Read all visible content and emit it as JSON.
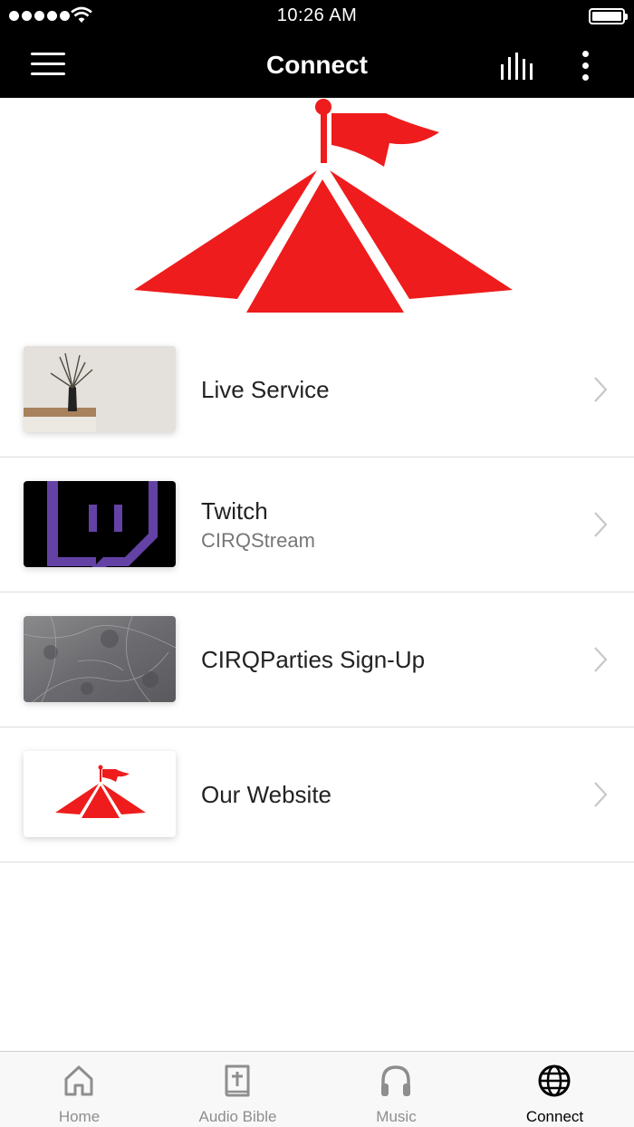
{
  "status_bar": {
    "time": "10:26 AM"
  },
  "nav": {
    "title": "Connect"
  },
  "colors": {
    "brand_red": "#ee1c1c",
    "nav_background": "#000000",
    "twitch_purple": "#6441a5",
    "inactive_tab": "#8e8e8e"
  },
  "list": [
    {
      "title": "Live Service",
      "subtitle": ""
    },
    {
      "title": "Twitch",
      "subtitle": "CIRQStream"
    },
    {
      "title": "CIRQParties Sign-Up",
      "subtitle": ""
    },
    {
      "title": "Our Website",
      "subtitle": ""
    }
  ],
  "tabs": [
    {
      "label": "Home",
      "icon": "home-icon",
      "active": false
    },
    {
      "label": "Audio Bible",
      "icon": "bible-icon",
      "active": false
    },
    {
      "label": "Music",
      "icon": "headphones-icon",
      "active": false
    },
    {
      "label": "Connect",
      "icon": "globe-icon",
      "active": true
    }
  ]
}
